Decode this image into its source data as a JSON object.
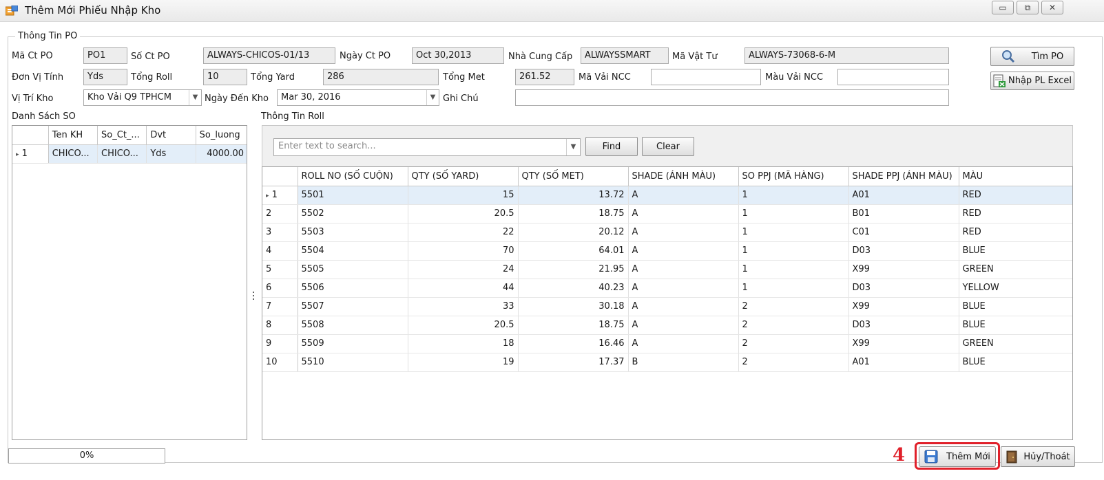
{
  "window": {
    "title": "Thêm Mới Phiếu Nhập Kho",
    "controls": {
      "minimize": "▭",
      "restore": "⧉",
      "close": "✕"
    }
  },
  "po_info": {
    "legend": "Thông Tin PO",
    "ma_ct_po": {
      "label": "Mã Ct PO",
      "value": "PO1"
    },
    "so_ct_po": {
      "label": "Số Ct PO",
      "value": "ALWAYS-CHICOS-01/13"
    },
    "ngay_ct_po": {
      "label": "Ngày Ct PO",
      "value": "Oct 30,2013"
    },
    "nha_cung_cap": {
      "label": "Nhà Cung Cấp",
      "value": "ALWAYSSMART"
    },
    "ma_vat_tu": {
      "label": "Mã Vật Tư",
      "value": "ALWAYS-73068-6-M"
    },
    "don_vi_tinh": {
      "label": "Đơn Vị Tính",
      "value": "Yds"
    },
    "tong_roll": {
      "label": "Tổng Roll",
      "value": "10"
    },
    "tong_yard": {
      "label": "Tổng Yard",
      "value": "286"
    },
    "tong_met": {
      "label": "Tổng Met",
      "value": "261.52"
    },
    "ma_vai_ncc": {
      "label": "Mã Vải NCC",
      "value": ""
    },
    "mau_vai_ncc": {
      "label": "Màu Vải NCC",
      "value": ""
    },
    "vi_tri_kho": {
      "label": "Vị Trí Kho",
      "value": "Kho Vải Q9 TPHCM"
    },
    "ngay_den_kho": {
      "label": "Ngày Đến Kho",
      "value": "Mar 30, 2016"
    },
    "ghi_chu": {
      "label": "Ghi Chú",
      "value": ""
    },
    "tim_po_button": "Tìm PO",
    "nhap_pl_excel_button": "Nhập PL Excel"
  },
  "so_list": {
    "title": "Danh Sách SO",
    "columns": [
      "",
      "Ten KH",
      "So_Ct_...",
      "Dvt",
      "So_luong"
    ],
    "rows": [
      {
        "indicator": "▸",
        "index": "1",
        "ten_kh": "CHICO...",
        "so_ct": "CHICO...",
        "dvt": "Yds",
        "so_luong": "4000.00"
      }
    ]
  },
  "roll_info": {
    "title": "Thông Tin Roll",
    "search_placeholder": "Enter text to search...",
    "find_button": "Find",
    "clear_button": "Clear",
    "columns": [
      "",
      "ROLL NO (SỐ CUỘN)",
      "QTY (SỐ YARD)",
      "QTY (SỐ MET)",
      "SHADE (ÁNH MÀU)",
      "SO PPJ (MÃ HÀNG)",
      "SHADE PPJ (ÁNH MÀU)",
      "MÀU"
    ],
    "rows": [
      {
        "index": "1",
        "roll_no": "5501",
        "qty_yard": "15",
        "qty_met": "13.72",
        "shade": "A",
        "so_ppj": "1",
        "shade_ppj": "A01",
        "mau": "RED"
      },
      {
        "index": "2",
        "roll_no": "5502",
        "qty_yard": "20.5",
        "qty_met": "18.75",
        "shade": "A",
        "so_ppj": "1",
        "shade_ppj": "B01",
        "mau": "RED"
      },
      {
        "index": "3",
        "roll_no": "5503",
        "qty_yard": "22",
        "qty_met": "20.12",
        "shade": "A",
        "so_ppj": "1",
        "shade_ppj": "C01",
        "mau": "RED"
      },
      {
        "index": "4",
        "roll_no": "5504",
        "qty_yard": "70",
        "qty_met": "64.01",
        "shade": "A",
        "so_ppj": "1",
        "shade_ppj": "D03",
        "mau": "BLUE"
      },
      {
        "index": "5",
        "roll_no": "5505",
        "qty_yard": "24",
        "qty_met": "21.95",
        "shade": "A",
        "so_ppj": "1",
        "shade_ppj": "X99",
        "mau": "GREEN"
      },
      {
        "index": "6",
        "roll_no": "5506",
        "qty_yard": "44",
        "qty_met": "40.23",
        "shade": "A",
        "so_ppj": "1",
        "shade_ppj": "D03",
        "mau": "YELLOW"
      },
      {
        "index": "7",
        "roll_no": "5507",
        "qty_yard": "33",
        "qty_met": "30.18",
        "shade": "A",
        "so_ppj": "2",
        "shade_ppj": "X99",
        "mau": "BLUE"
      },
      {
        "index": "8",
        "roll_no": "5508",
        "qty_yard": "20.5",
        "qty_met": "18.75",
        "shade": "A",
        "so_ppj": "2",
        "shade_ppj": "D03",
        "mau": "BLUE"
      },
      {
        "index": "9",
        "roll_no": "5509",
        "qty_yard": "18",
        "qty_met": "16.46",
        "shade": "A",
        "so_ppj": "2",
        "shade_ppj": "X99",
        "mau": "GREEN"
      },
      {
        "index": "10",
        "roll_no": "5510",
        "qty_yard": "19",
        "qty_met": "17.37",
        "shade": "B",
        "so_ppj": "2",
        "shade_ppj": "A01",
        "mau": "BLUE"
      }
    ],
    "selected_row_indicator": "▸"
  },
  "footer": {
    "progress": "0%",
    "progress_fraction": 0,
    "step_number": "4",
    "them_moi_button": "Thêm Mới",
    "huy_thoat_button": "Hủy/Thoát"
  },
  "colors": {
    "highlight": "#e0202a",
    "selection": "#e3eef9"
  }
}
